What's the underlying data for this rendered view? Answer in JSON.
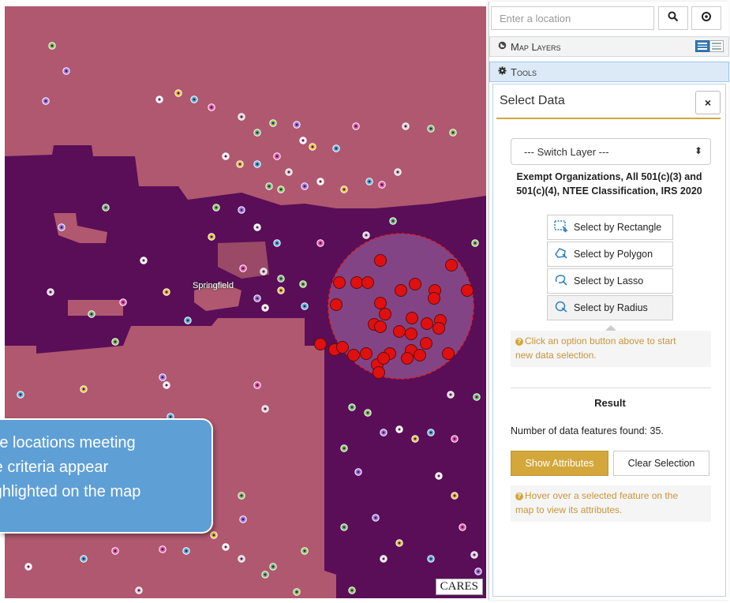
{
  "search": {
    "placeholder": "Enter a location",
    "search_icon": "search-icon",
    "locate_icon": "crosshair-icon"
  },
  "panel": {
    "map_layers_label": "Map Layers",
    "tools_label": "Tools",
    "select_data": {
      "title": "Select Data",
      "close_label": "×",
      "switch_layer": "--- Switch Layer ---",
      "layer_name_line1": "Exempt Organizations, All 501(c)(3) and",
      "layer_name_line2": "501(c)(4), NTEE Classification, IRS 2020",
      "buttons": [
        {
          "label": "Select by Rectangle",
          "icon": "rectangle-select-icon"
        },
        {
          "label": "Select by Polygon",
          "icon": "polygon-select-icon"
        },
        {
          "label": "Select by Lasso",
          "icon": "lasso-select-icon"
        },
        {
          "label": "Select by Radius",
          "icon": "radius-select-icon"
        }
      ],
      "hint_line1": "Click an option button above to start",
      "hint_line2": "new data selection.",
      "result_title": "Result",
      "found_text": "Number of data features found: 35.",
      "show_attributes": "Show Attributes",
      "clear_selection": "Clear Selection",
      "hover_hint_line1": "Hover over a selected feature on the",
      "hover_hint_line2": "map to view its attributes."
    }
  },
  "map": {
    "city_label": "Springfield",
    "attribution": "CARES",
    "colors": {
      "base": "#b0586f",
      "dark": "#5a0e57",
      "selection_fill": "#8b4e8e",
      "selection_stroke": "#e02020",
      "point": "#e01010"
    }
  },
  "callout": {
    "line1": "The locations meeting",
    "line2": "the criteria appear",
    "line3": "highlighted on the map"
  },
  "colors": {
    "accent": "#d4a73a",
    "tools_bg": "#dceaf7",
    "callout_bg": "#5e9fd6"
  }
}
